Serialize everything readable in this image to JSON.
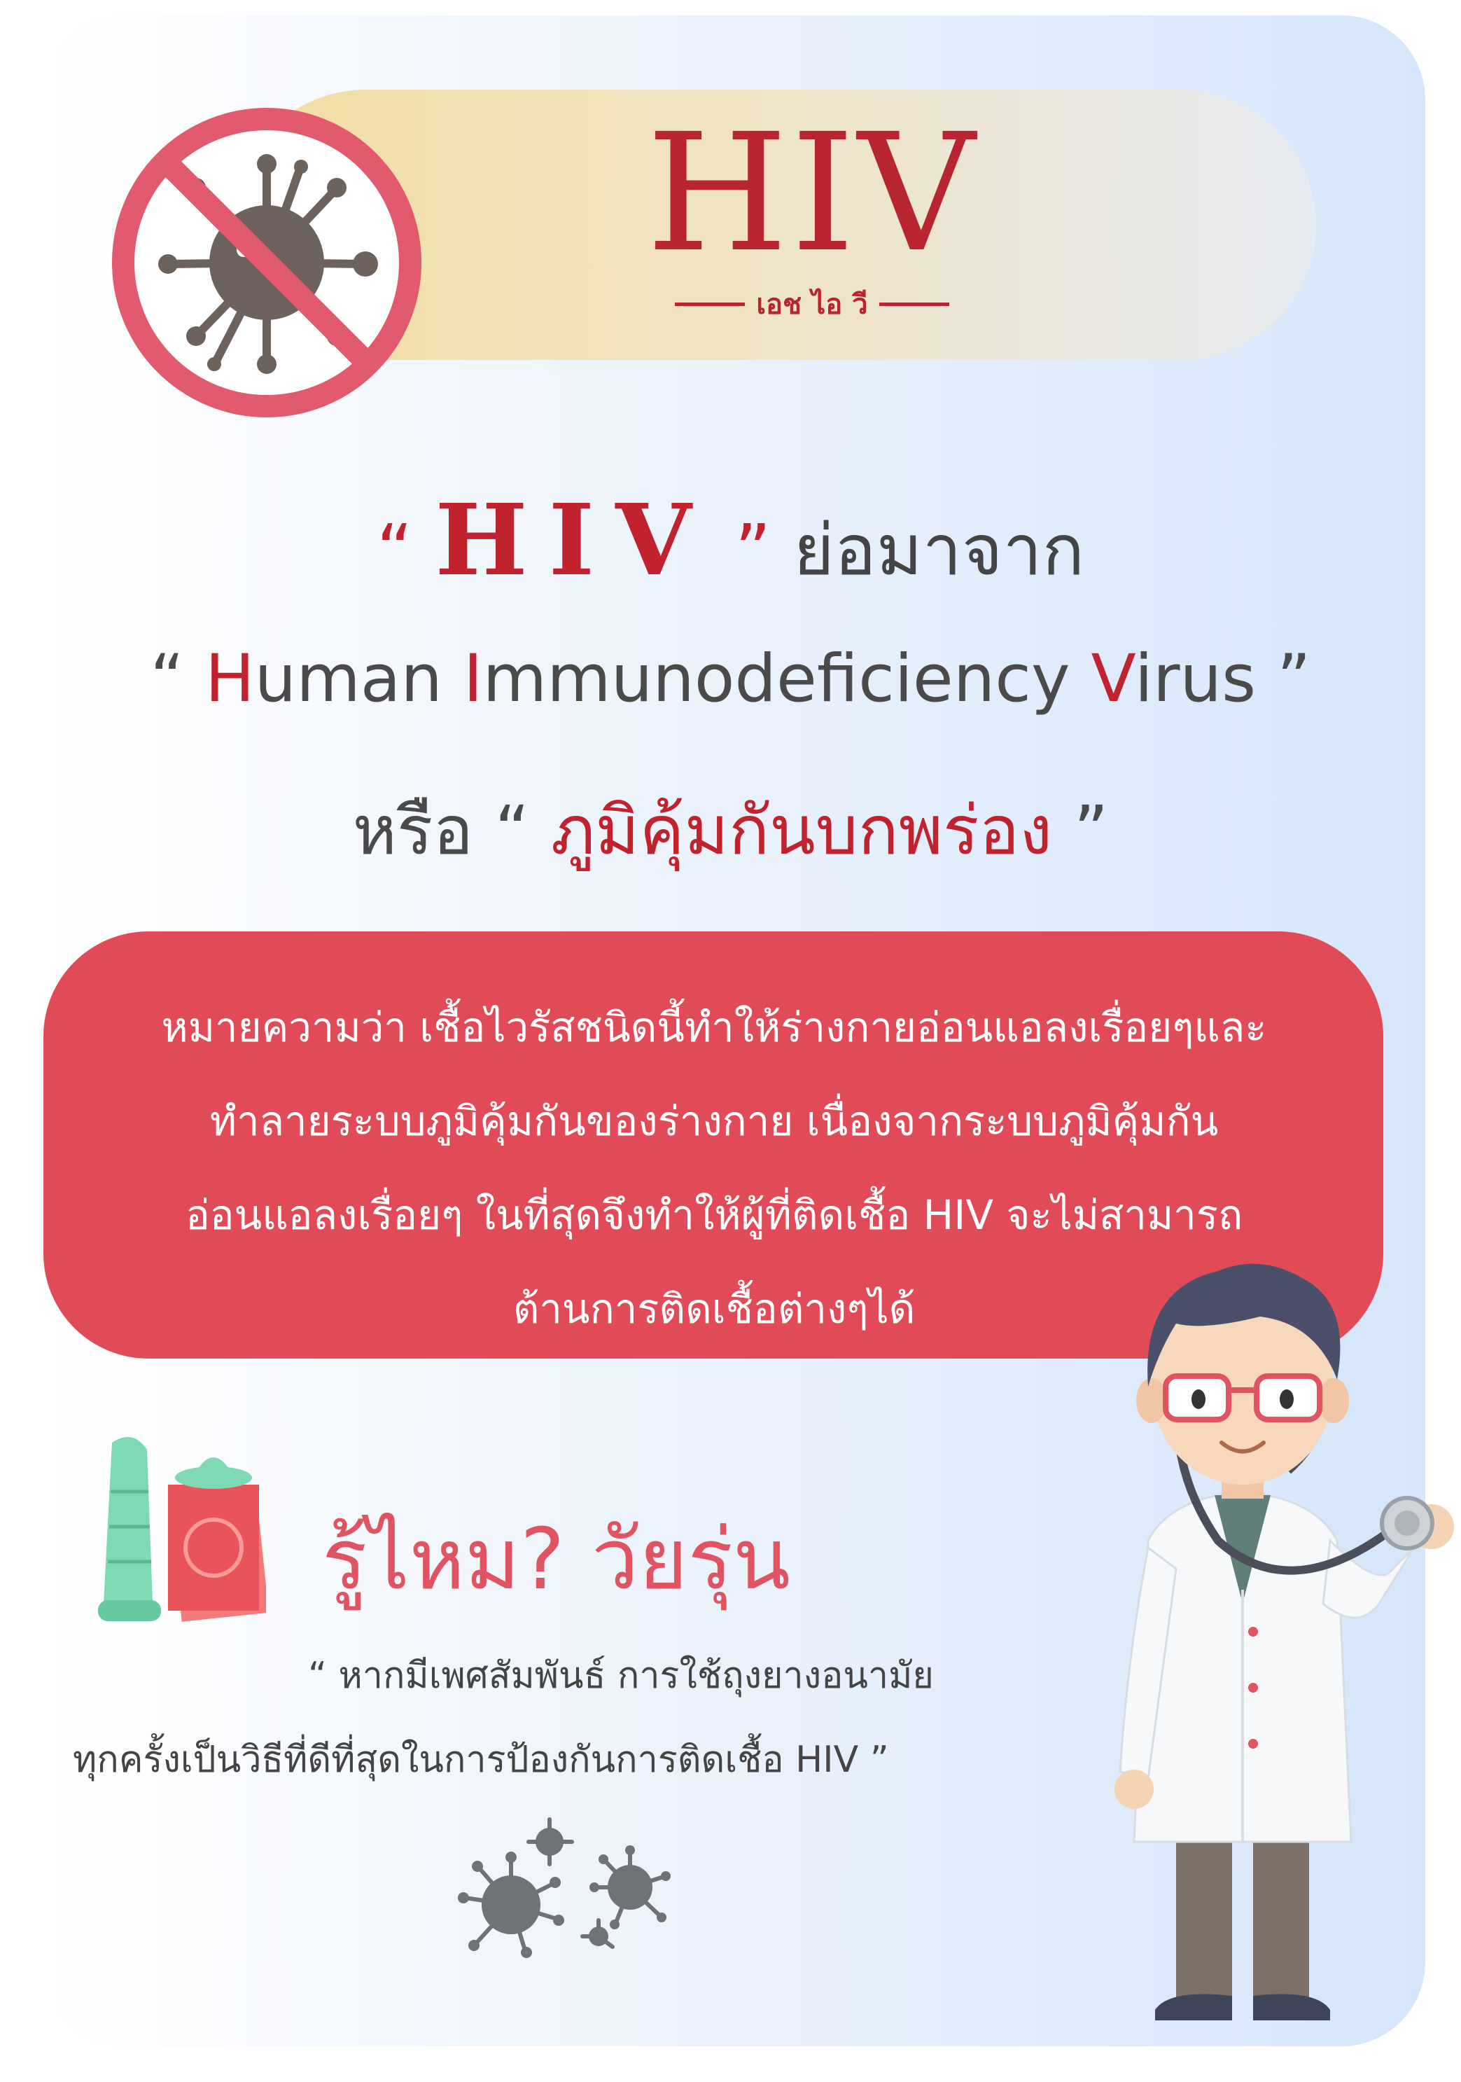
{
  "header": {
    "title": "HIV",
    "subtitle": "เอช ไอ วี"
  },
  "definition": {
    "open_quote": "“",
    "acronym": "HIV",
    "close_quote": "”",
    "abbrev_from": "ย่อมาจาก",
    "line2_open": "“ ",
    "word_h": "H",
    "word_h_rest": "uman ",
    "word_i": "I",
    "word_i_rest": "mmunodeficiency ",
    "word_v": "V",
    "word_v_rest": "irus",
    "line2_close": " ”",
    "or_label": "หรือ",
    "thai_open": " “ ",
    "thai_term": "ภูมิคุ้มกันบกพร่อง",
    "thai_close": " ”"
  },
  "meaning": {
    "lines": [
      "หมายความว่า เชื้อไวรัสชนิดนี้ทำให้ร่างกายอ่อนแอลงเรื่อยๆและ",
      "ทำลายระบบภูมิคุ้มกันของร่างกาย เนื่องจากระบบภูมิคุ้มกัน",
      "อ่อนแอลงเรื่อยๆ ในที่สุดจึงทำให้ผู้ที่ติดเชื้อ HIV จะไม่สามารถ",
      "ต้านการติดเชื้อต่างๆได้"
    ]
  },
  "tip": {
    "heading": "รู้ไหม? วัยรุ่น",
    "quote_line1": "“ หากมีเพศสัมพันธ์ การใช้ถุงยางอนามัย",
    "quote_line2": "ทุกครั้งเป็นวิธีที่ดีที่สุดในการป้องกันการติดเชื้อ HIV  ”"
  },
  "icons": {
    "ban": "no-virus-icon",
    "condom": "condom-icon",
    "viruses": "virus-cluster-icon",
    "doctor": "doctor-illustration"
  },
  "colors": {
    "accent_red": "#c0232e",
    "box_red": "#e14a57",
    "heading_pink": "#e05461",
    "text_gray": "#444444"
  }
}
